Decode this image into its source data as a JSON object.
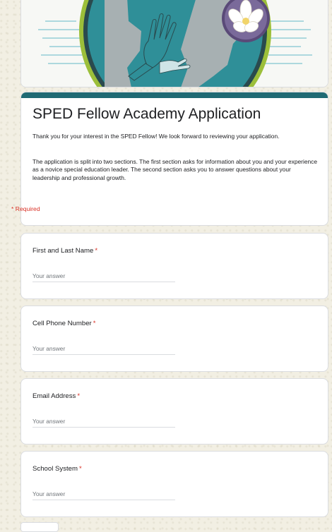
{
  "form": {
    "title": "SPED Fellow Academy Application",
    "description_1": "Thank you for your interest in the SPED Fellow! We look forward to reviewing your application.",
    "description_2": "The application is split into two sections. The first section asks for information about you and your experience as a novice special education leader. The second section asks you to answer questions about your leadership and professional growth.",
    "required_note": "* Required",
    "accent_color": "#1f6a73",
    "required_color": "#d93025"
  },
  "banner": {
    "icon": "hands-and-magnolia-emblem",
    "colors": {
      "teal": "#2f8f98",
      "lime": "#9cbf3a",
      "gray": "#a7b0b2",
      "dark": "#2a3a3c"
    }
  },
  "questions": [
    {
      "label": "First and Last Name",
      "required_mark": "*",
      "placeholder": "Your answer"
    },
    {
      "label": "Cell Phone Number",
      "required_mark": "*",
      "placeholder": "Your answer"
    },
    {
      "label": "Email Address",
      "required_mark": "*",
      "placeholder": "Your answer"
    },
    {
      "label": "School System",
      "required_mark": "*",
      "placeholder": "Your answer"
    }
  ]
}
